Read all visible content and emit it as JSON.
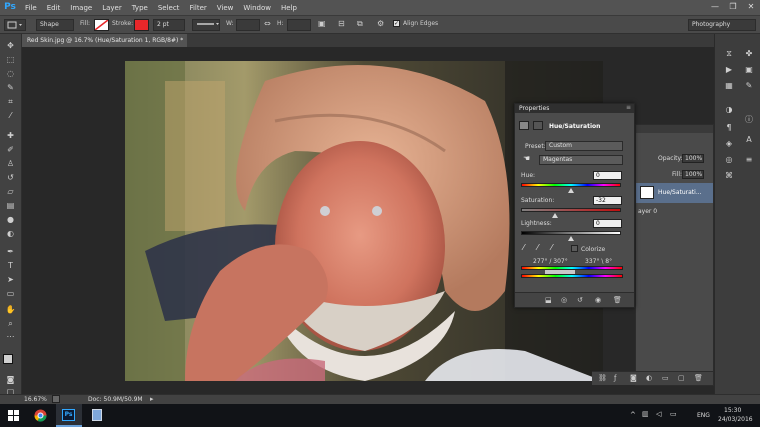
{
  "app": {
    "logo": "Ps"
  },
  "menu": [
    "File",
    "Edit",
    "Image",
    "Layer",
    "Type",
    "Select",
    "Filter",
    "View",
    "Window",
    "Help"
  ],
  "window_controls": [
    "—",
    "❐",
    "✕"
  ],
  "options_bar": {
    "shape_mode": "Shape",
    "fill_label": "Fill:",
    "stroke_label": "Stroke:",
    "stroke_color": "#e8272a",
    "stroke_width": "2 pt",
    "w_label": "W:",
    "h_label": "H:",
    "align_edges": "Align Edges",
    "workspace": "Photography"
  },
  "document_tab": {
    "title": "Red Skin.jpg @ 16.7% (Hue/Saturation 1, RGB/8#) *",
    "close": "✕"
  },
  "properties": {
    "tab": "Properties",
    "title": "Hue/Saturation",
    "preset_label": "Preset:",
    "preset_value": "Custom",
    "channel_value": "Magentas",
    "hue_label": "Hue:",
    "hue_value": "0",
    "saturation_label": "Saturation:",
    "saturation_value": "-32",
    "lightness_label": "Lightness:",
    "lightness_value": "0",
    "colorize_label": "Colorize",
    "range_left": "277° / 307°",
    "range_right": "337° \\ 8°"
  },
  "layers": {
    "opacity_label": "Opacity:",
    "opacity_value": "100%",
    "fill_label": "Fill:",
    "fill_value": "100%",
    "layer_name": "Hue/Saturati...",
    "background_layer": "ayer 0"
  },
  "statusbar": {
    "zoom": "16.67%",
    "doc": "Doc: 50.9M/50.9M"
  },
  "taskbar": {
    "lang": "ENG",
    "time": "15:30",
    "date": "24/03/2016"
  },
  "colors": {
    "accent": "#31a8ff",
    "panel": "#4c4c4c",
    "canvas": "#282828"
  }
}
